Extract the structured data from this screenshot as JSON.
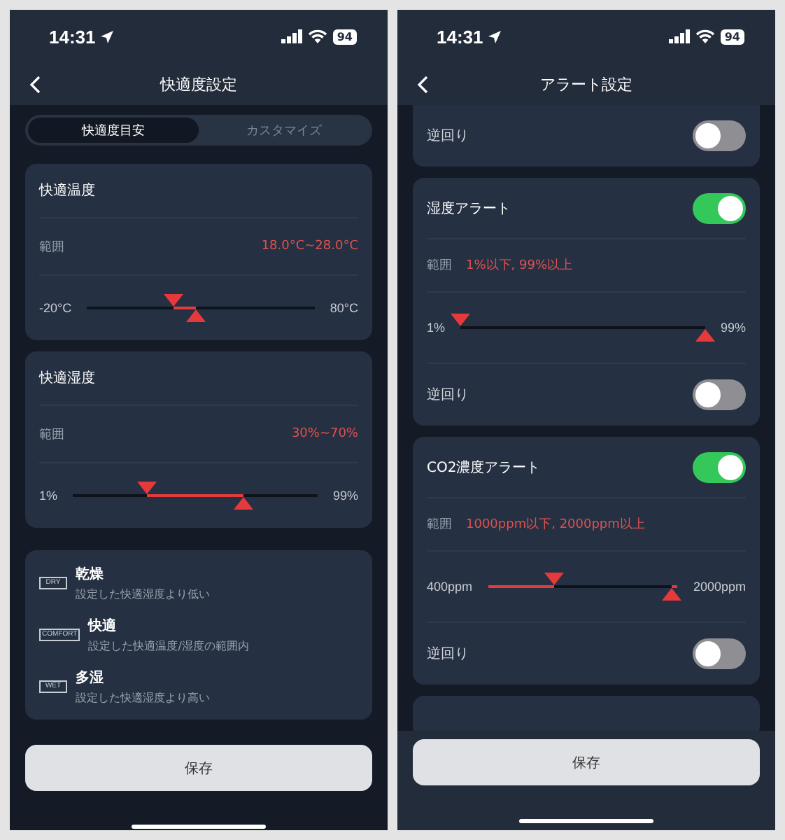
{
  "screens": [
    {
      "status": {
        "time": "14:31",
        "battery": "94"
      },
      "title": "快適度設定",
      "tabs": [
        {
          "label": "快適度目安",
          "selected": true
        },
        {
          "label": "カスタマイズ",
          "selected": false
        }
      ],
      "cards": [
        {
          "kind": "comfort",
          "rows": [
            {
              "kind": "title",
              "text": "快適温度"
            },
            {
              "kind": "range",
              "label": "範囲",
              "value": "18.0°C~28.0°C"
            },
            {
              "kind": "slider",
              "min_label": "-20°C",
              "max_label": "80°C",
              "inverted": false,
              "low": {
                "level": 0.38
              },
              "high": {
                "level": 0.48
              }
            }
          ]
        },
        {
          "kind": "comfort",
          "rows": [
            {
              "kind": "title",
              "text": "快適湿度"
            },
            {
              "kind": "range",
              "label": "範囲",
              "value": "30%~70%"
            },
            {
              "kind": "slider",
              "min_label": "1%",
              "max_label": "99%",
              "inverted": false,
              "low": {
                "level": 0.3
              },
              "high": {
                "level": 0.7
              }
            }
          ]
        }
      ],
      "legend": [
        {
          "badge": "DRY",
          "title": "乾燥",
          "description": "設定した快適湿度より低い"
        },
        {
          "badge": "COMFORT",
          "title": "快適",
          "description": "設定した快適温度/湿度の範囲内"
        },
        {
          "badge": "WET",
          "title": "多湿",
          "description": "設定した快適湿度より高い"
        }
      ],
      "save": "保存"
    },
    {
      "status": {
        "time": "14:31",
        "battery": "94"
      },
      "title": "アラート設定",
      "cards": [
        {
          "kind": "alert",
          "rows": [
            {
              "kind": "switch",
              "label": "逆回り",
              "on": false
            }
          ]
        },
        {
          "kind": "alert",
          "rows": [
            {
              "kind": "title",
              "text": "湿度アラート",
              "on": true
            },
            {
              "kind": "range",
              "label": "範囲",
              "value": "1%以下, 99%以上"
            },
            {
              "kind": "slider",
              "min_label": "1%",
              "max_label": "99%",
              "inverted": true,
              "low": {
                "level": 0
              },
              "high": {
                "level": 1
              }
            },
            {
              "kind": "switch",
              "label": "逆回り",
              "on": false
            }
          ]
        },
        {
          "kind": "alert",
          "rows": [
            {
              "kind": "title",
              "text": "CO2濃度アラート",
              "on": true
            },
            {
              "kind": "range",
              "label": "範囲",
              "value": "1000ppm以下, 2000ppm以上"
            },
            {
              "kind": "slider",
              "min_label": "400ppm",
              "max_label": "2000ppm",
              "inverted": true,
              "low": {
                "level": 0.35
              },
              "high": {
                "level": 0.97
              }
            },
            {
              "kind": "switch",
              "label": "逆回り",
              "on": false
            }
          ]
        }
      ],
      "more_below": true,
      "save": "保存"
    }
  ]
}
